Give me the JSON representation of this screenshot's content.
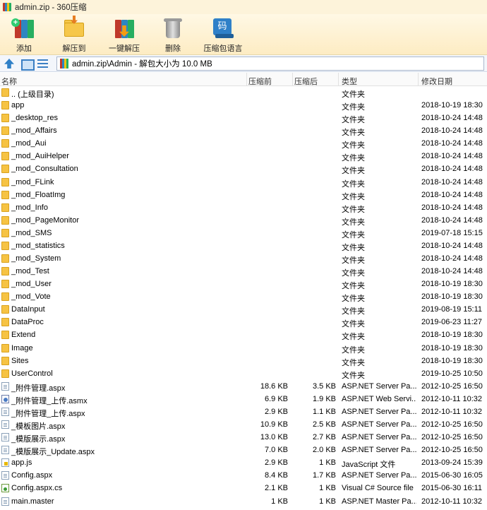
{
  "window": {
    "title": "admin.zip - 360压缩"
  },
  "toolbar": {
    "buttons": [
      {
        "label": "添加",
        "icon": "add-archive-icon"
      },
      {
        "label": "解压到",
        "icon": "extract-to-icon"
      },
      {
        "label": "一键解压",
        "icon": "one-click-extract-icon"
      },
      {
        "label": "删除",
        "icon": "delete-icon"
      },
      {
        "label": "压缩包语言",
        "icon": "archive-language-icon",
        "glyph": "码"
      }
    ]
  },
  "address": {
    "path": "admin.zip\\Admin - 解包大小为 10.0 MB"
  },
  "columns": {
    "name": "名称",
    "packed": "压缩前",
    "unpacked": "压缩后",
    "type": "类型",
    "modified": "修改日期"
  },
  "files": [
    {
      "icon": "folder",
      "name": ".. (上级目录)",
      "packed": "",
      "unpacked": "",
      "type": "文件夹",
      "date": ""
    },
    {
      "icon": "folder",
      "name": "app",
      "packed": "",
      "unpacked": "",
      "type": "文件夹",
      "date": "2018-10-19 18:30"
    },
    {
      "icon": "folder",
      "name": "_desktop_res",
      "packed": "",
      "unpacked": "",
      "type": "文件夹",
      "date": "2018-10-24 14:48"
    },
    {
      "icon": "folder",
      "name": "_mod_Affairs",
      "packed": "",
      "unpacked": "",
      "type": "文件夹",
      "date": "2018-10-24 14:48"
    },
    {
      "icon": "folder",
      "name": "_mod_Aui",
      "packed": "",
      "unpacked": "",
      "type": "文件夹",
      "date": "2018-10-24 14:48"
    },
    {
      "icon": "folder",
      "name": "_mod_AuiHelper",
      "packed": "",
      "unpacked": "",
      "type": "文件夹",
      "date": "2018-10-24 14:48"
    },
    {
      "icon": "folder",
      "name": "_mod_Consultation",
      "packed": "",
      "unpacked": "",
      "type": "文件夹",
      "date": "2018-10-24 14:48"
    },
    {
      "icon": "folder",
      "name": "_mod_FLink",
      "packed": "",
      "unpacked": "",
      "type": "文件夹",
      "date": "2018-10-24 14:48"
    },
    {
      "icon": "folder",
      "name": "_mod_FloatImg",
      "packed": "",
      "unpacked": "",
      "type": "文件夹",
      "date": "2018-10-24 14:48"
    },
    {
      "icon": "folder",
      "name": "_mod_Info",
      "packed": "",
      "unpacked": "",
      "type": "文件夹",
      "date": "2018-10-24 14:48"
    },
    {
      "icon": "folder",
      "name": "_mod_PageMonitor",
      "packed": "",
      "unpacked": "",
      "type": "文件夹",
      "date": "2018-10-24 14:48"
    },
    {
      "icon": "folder",
      "name": "_mod_SMS",
      "packed": "",
      "unpacked": "",
      "type": "文件夹",
      "date": "2019-07-18 15:15"
    },
    {
      "icon": "folder",
      "name": "_mod_statistics",
      "packed": "",
      "unpacked": "",
      "type": "文件夹",
      "date": "2018-10-24 14:48"
    },
    {
      "icon": "folder",
      "name": "_mod_System",
      "packed": "",
      "unpacked": "",
      "type": "文件夹",
      "date": "2018-10-24 14:48"
    },
    {
      "icon": "folder",
      "name": "_mod_Test",
      "packed": "",
      "unpacked": "",
      "type": "文件夹",
      "date": "2018-10-24 14:48"
    },
    {
      "icon": "folder",
      "name": "_mod_User",
      "packed": "",
      "unpacked": "",
      "type": "文件夹",
      "date": "2018-10-19 18:30"
    },
    {
      "icon": "folder",
      "name": "_mod_Vote",
      "packed": "",
      "unpacked": "",
      "type": "文件夹",
      "date": "2018-10-19 18:30"
    },
    {
      "icon": "folder",
      "name": "DataInput",
      "packed": "",
      "unpacked": "",
      "type": "文件夹",
      "date": "2019-08-19 15:11"
    },
    {
      "icon": "folder",
      "name": "DataProc",
      "packed": "",
      "unpacked": "",
      "type": "文件夹",
      "date": "2019-06-23 11:27"
    },
    {
      "icon": "folder",
      "name": "Extend",
      "packed": "",
      "unpacked": "",
      "type": "文件夹",
      "date": "2018-10-19 18:30"
    },
    {
      "icon": "folder",
      "name": "Image",
      "packed": "",
      "unpacked": "",
      "type": "文件夹",
      "date": "2018-10-19 18:30"
    },
    {
      "icon": "folder",
      "name": "Sites",
      "packed": "",
      "unpacked": "",
      "type": "文件夹",
      "date": "2018-10-19 18:30"
    },
    {
      "icon": "folder",
      "name": "UserControl",
      "packed": "",
      "unpacked": "",
      "type": "文件夹",
      "date": "2019-10-25 10:50"
    },
    {
      "icon": "aspx",
      "name": "_附件管理.aspx",
      "packed": "18.6 KB",
      "unpacked": "3.5 KB",
      "type": "ASP.NET Server Pa...",
      "date": "2012-10-25 16:50"
    },
    {
      "icon": "asmx",
      "name": "_附件管理_上传.asmx",
      "packed": "6.9 KB",
      "unpacked": "1.9 KB",
      "type": "ASP.NET Web Servi...",
      "date": "2012-10-11 10:32"
    },
    {
      "icon": "aspx",
      "name": "_附件管理_上传.aspx",
      "packed": "2.9 KB",
      "unpacked": "1.1 KB",
      "type": "ASP.NET Server Pa...",
      "date": "2012-10-11 10:32"
    },
    {
      "icon": "aspx",
      "name": "_模板图片.aspx",
      "packed": "10.9 KB",
      "unpacked": "2.5 KB",
      "type": "ASP.NET Server Pa...",
      "date": "2012-10-25 16:50"
    },
    {
      "icon": "aspx",
      "name": "_模版展示.aspx",
      "packed": "13.0 KB",
      "unpacked": "2.7 KB",
      "type": "ASP.NET Server Pa...",
      "date": "2012-10-25 16:50"
    },
    {
      "icon": "aspx",
      "name": "_模版展示_Update.aspx",
      "packed": "7.0 KB",
      "unpacked": "2.0 KB",
      "type": "ASP.NET Server Pa...",
      "date": "2012-10-25 16:50"
    },
    {
      "icon": "js",
      "name": "app.js",
      "packed": "2.9 KB",
      "unpacked": "1 KB",
      "type": "JavaScript 文件",
      "date": "2013-09-24 15:39"
    },
    {
      "icon": "aspx",
      "name": "Config.aspx",
      "packed": "8.4 KB",
      "unpacked": "1.7 KB",
      "type": "ASP.NET Server Pa...",
      "date": "2015-06-30 16:05"
    },
    {
      "icon": "cs",
      "name": "Config.aspx.cs",
      "packed": "2.1 KB",
      "unpacked": "1 KB",
      "type": "Visual C# Source file",
      "date": "2015-06-30 16:11"
    },
    {
      "icon": "aspx",
      "name": "main.master",
      "packed": "1 KB",
      "unpacked": "1 KB",
      "type": "ASP.NET Master Pa...",
      "date": "2012-10-11 10:32"
    }
  ]
}
